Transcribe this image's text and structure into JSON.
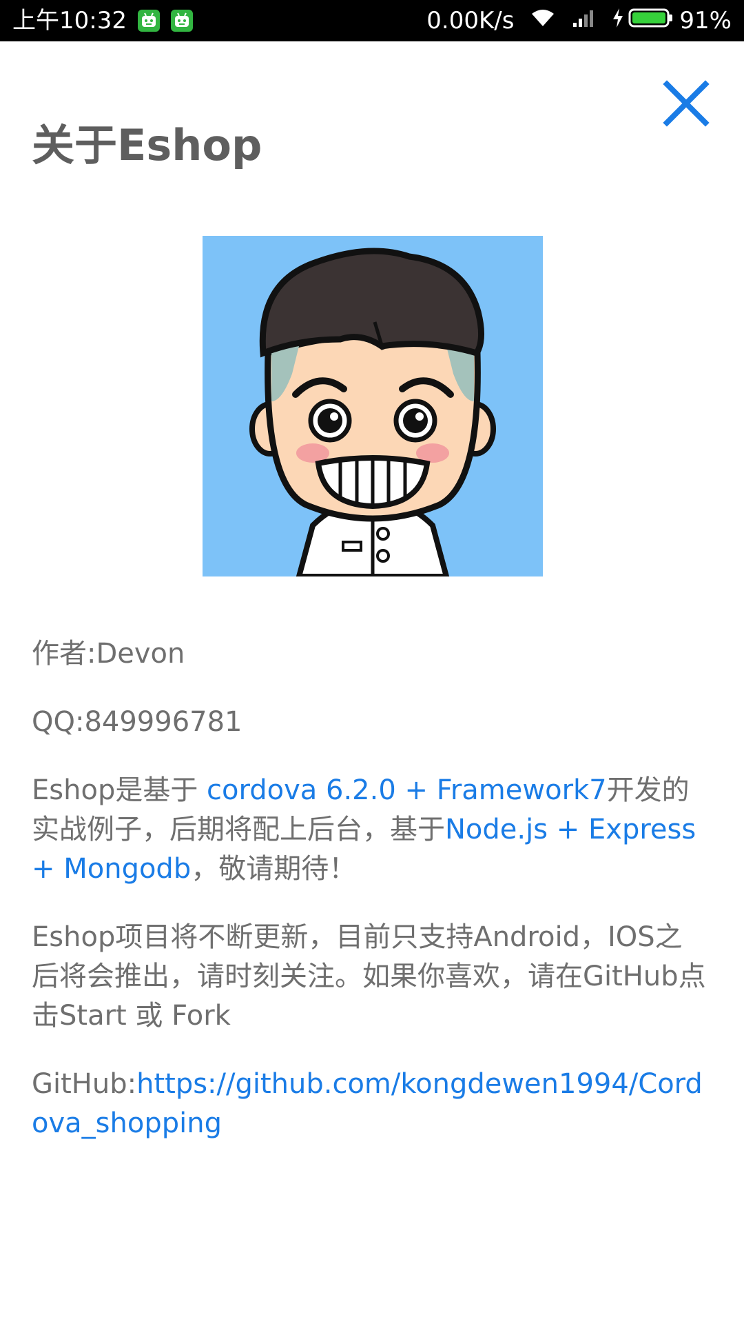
{
  "status_bar": {
    "time": "上午10:32",
    "network_speed": "0.00K/s",
    "battery": "91%",
    "colors": {
      "background": "#000000",
      "notification_icon": "#32b541",
      "battery_fill": "#36d13b"
    },
    "icons": [
      "android-notification-icon",
      "android-notification-icon",
      "wifi-icon",
      "signal-icon",
      "charging-icon",
      "battery-icon"
    ]
  },
  "header": {
    "title": "关于Eshop",
    "close_icon": "close-icon",
    "close_color": "#1a7ce6"
  },
  "avatar": {
    "icon": "cartoon-avatar-illustration",
    "background": "#7dc2f8"
  },
  "content": {
    "author": "作者:Devon",
    "qq": "QQ:849996781",
    "intro": {
      "part1": "Eshop是基于 ",
      "link1": "cordova 6.2.0",
      "plus1": " + ",
      "link2": "Framework7",
      "part2": "开发的实战例子，后期将配上后台，基于",
      "link3": "Node.js",
      "plus2": " + ",
      "link4": "Express",
      "plus3": " + ",
      "link5": "Mongodb",
      "part3": "，敬请期待！"
    },
    "update_note": "Eshop项目将不断更新，目前只支持Android，IOS之后将会推出，请时刻关注。如果你喜欢，请在GitHub点击Start 或 Fork",
    "github_label": "GitHub:",
    "github_url": "https://github.com/kongdewen1994/Cordova_shopping"
  },
  "colors": {
    "text": "#6f6f6f",
    "title": "#5e5e5e",
    "link": "#1a7ce6"
  }
}
